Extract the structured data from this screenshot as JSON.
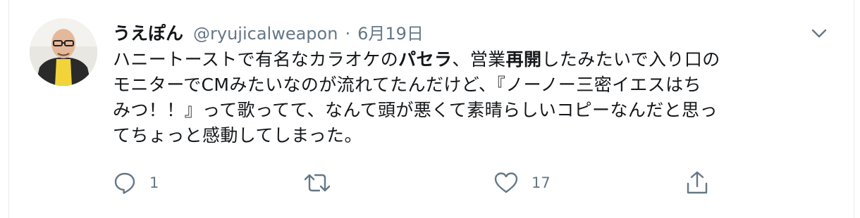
{
  "tweet": {
    "display_name": "うえぽん",
    "handle": "@ryujicalweapon",
    "separator": "·",
    "date": "6月19日",
    "text_lines": [
      {
        "a": "ハニートーストで有名なカラオケの",
        "b1": "パセラ",
        "c": "、営業",
        "b2": "再開",
        "d": "したみたいで入り口の"
      },
      "モニターでCMみたいなのが流れてたんだけど、『ノーノー三密イエスはち",
      "みつ！！』って歌ってて、なんて頭が悪くて素晴らしいコピーなんだと思っ",
      "てちょっと感動してしまった。"
    ]
  },
  "actions": {
    "reply": {
      "icon": "reply-icon",
      "count": "1"
    },
    "retweet": {
      "icon": "retweet-icon",
      "count": ""
    },
    "like": {
      "icon": "heart-icon",
      "count": "17"
    },
    "share": {
      "icon": "share-icon",
      "count": ""
    }
  },
  "colors": {
    "text": "#14171a",
    "secondary": "#657786",
    "border": "#e6ecf0"
  }
}
